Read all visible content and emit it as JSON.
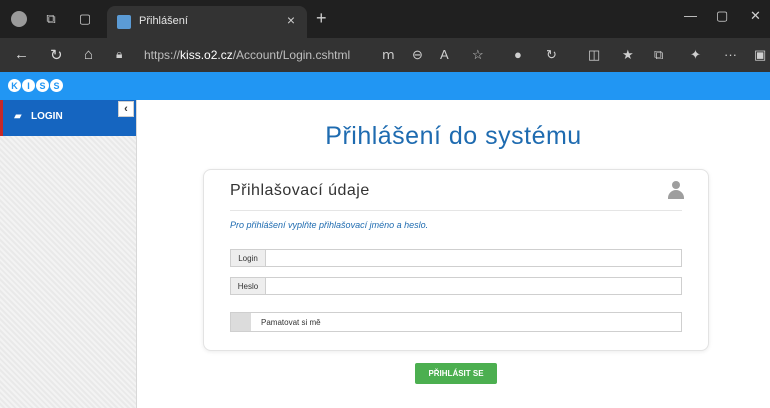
{
  "browser": {
    "tab_title": "Přihlášení",
    "tab_close": "×",
    "new_tab": "+",
    "url_prefix": "https://",
    "url_host": "kiss.o2.cz",
    "url_path": "/Account/Login.cshtml",
    "window_controls": [
      "—",
      "▢",
      "✕"
    ],
    "more": "···"
  },
  "app": {
    "logo_letters": [
      "K",
      "I",
      "S",
      "S"
    ],
    "accent_color": "#2196f3"
  },
  "sidebar": {
    "items": [
      {
        "label": "LOGIN",
        "icon": "login-icon",
        "active": true
      }
    ],
    "collapse_glyph": "‹"
  },
  "main": {
    "page_title": "Přihlášení do systému",
    "card": {
      "title": "Přihlašovací údaje",
      "hint": "Pro přihlášení vyplňte přihlašovací jméno a heslo.",
      "login_label": "Login",
      "login_value": "",
      "password_label": "Heslo",
      "password_value": "",
      "remember_label": "Pamatovat si mě"
    },
    "submit_label": "PŘIHLÁSIT SE",
    "submit_color": "#4caf50"
  }
}
